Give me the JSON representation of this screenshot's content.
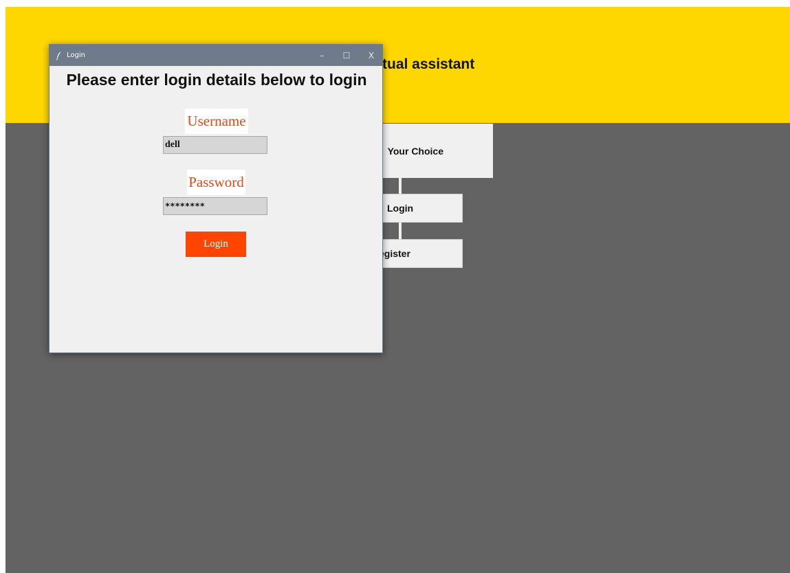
{
  "background_app": {
    "title_fragment": "tual assistant",
    "choice_label": "Your Choice",
    "login_button": "Login",
    "register_button": "egister"
  },
  "dialog": {
    "window_title": "Login",
    "controls": {
      "minimize": "–",
      "maximize": "☐",
      "close": "X"
    },
    "heading": "Please enter login details below to login",
    "username_label": "Username",
    "username_value": "dell",
    "password_label": "Password",
    "password_value": "********",
    "login_button": "Login"
  },
  "colors": {
    "header_yellow": "#ffd700",
    "background_gray": "#636363",
    "titlebar": "#6f7b8b",
    "label_orange": "#e14a16",
    "button_orange": "#ff4500"
  },
  "icons": {
    "window_icon": "feather-icon"
  }
}
